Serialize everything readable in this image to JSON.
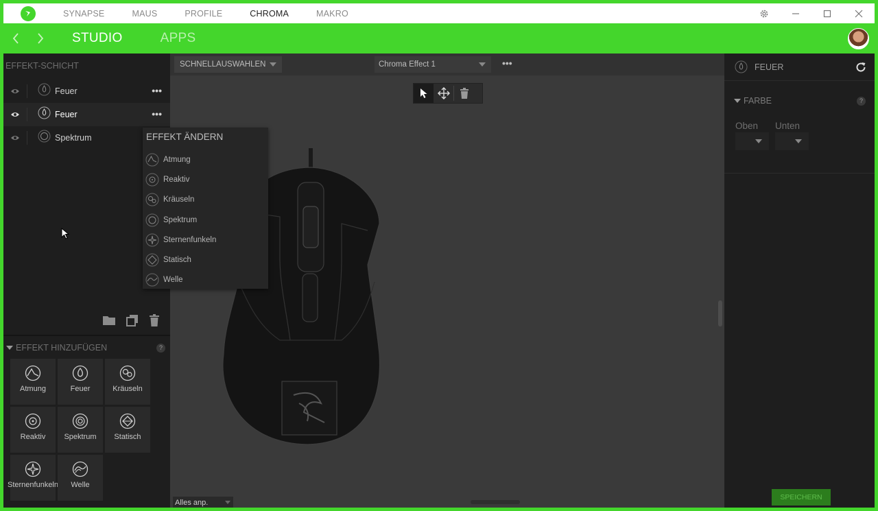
{
  "titlebar": {
    "tabs": [
      "SYNAPSE",
      "MAUS",
      "PROFILE",
      "CHROMA",
      "MAKRO"
    ],
    "active_tab": "CHROMA"
  },
  "subbar": {
    "tabs": [
      "STUDIO",
      "APPS"
    ]
  },
  "layers": {
    "header": "EFFEKT-SCHICHT",
    "items": [
      {
        "name": "Feuer"
      },
      {
        "name": "Feuer"
      },
      {
        "name": "Spektrum"
      }
    ]
  },
  "add_effect": {
    "header": "EFFEKT HINZUFÜGEN",
    "help": "?",
    "tiles": [
      "Atmung",
      "Feuer",
      "Kräuseln",
      "Reaktiv",
      "Spektrum",
      "Statisch",
      "Sternenfunkeln",
      "Welle"
    ]
  },
  "toolbar": {
    "quick_select": "SCHNELLAUSWAHLEN",
    "effect_name": "Chroma Effect 1",
    "more": "•••"
  },
  "popup": {
    "title": "EFFEKT ÄNDERN",
    "items": [
      "Atmung",
      "Reaktiv",
      "Kräuseln",
      "Spektrum",
      "Sternenfunkeln",
      "Statisch",
      "Welle"
    ]
  },
  "bottom": {
    "select_all": "Alles anp."
  },
  "right_panel": {
    "title": "FEUER",
    "section": "FARBE",
    "help": "?",
    "label_top": "Oben",
    "label_bottom": "Unten",
    "save": "SPEICHERN"
  },
  "colors": {
    "accent": "#44d62c",
    "panel": "#1e1e1e",
    "canvas": "#3a3a3a"
  }
}
